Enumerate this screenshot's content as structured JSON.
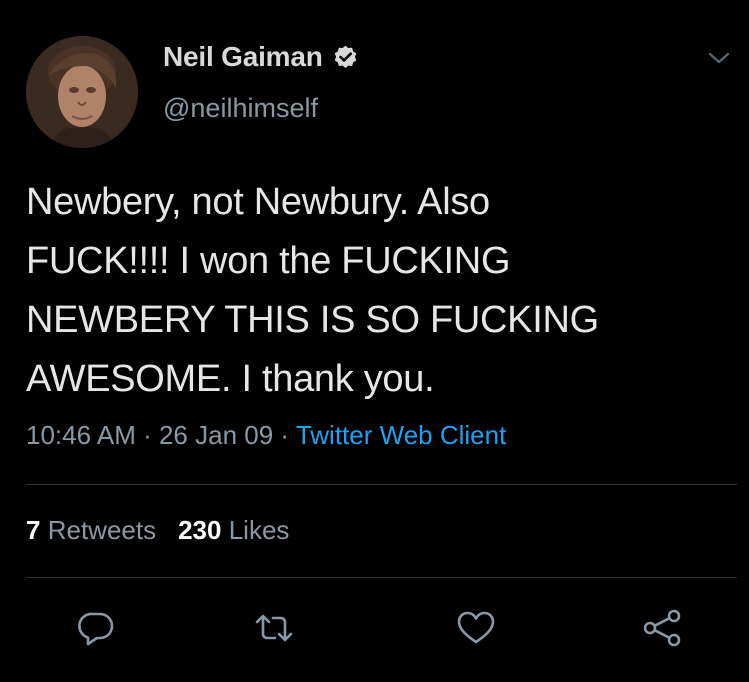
{
  "user": {
    "display_name": "Neil Gaiman",
    "handle": "@neilhimself",
    "verified": true
  },
  "tweet": {
    "lines": [
      "Newbery, not Newbury. Also",
      "FUCK!!!! I won the FUCKING",
      "NEWBERY THIS IS SO FUCKING",
      "AWESOME. I thank you."
    ],
    "time": "10:46 AM",
    "separator": " · ",
    "date": "26 Jan 09",
    "source": "Twitter Web Client"
  },
  "stats": {
    "retweets_count": "7",
    "retweets_label": "Retweets",
    "likes_count": "230",
    "likes_label": "Likes"
  },
  "icons": {
    "verified": "verified-badge-icon",
    "more": "chevron-down-icon",
    "reply": "reply-icon",
    "retweet": "retweet-icon",
    "like": "heart-icon",
    "share": "share-icon"
  },
  "colors": {
    "background": "#000000",
    "text": "#e6e6e6",
    "secondary": "#8899a6",
    "accent": "#1da1f2",
    "divider": "#2f3336"
  }
}
